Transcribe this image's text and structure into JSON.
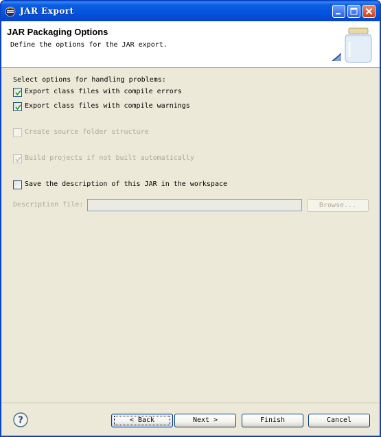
{
  "window": {
    "title": "JAR Export"
  },
  "header": {
    "title": "JAR Packaging Options",
    "description": "Define the options for the JAR export."
  },
  "options": {
    "section_label": "Select options for handling problems:",
    "items": [
      {
        "label": "Export class files with compile errors",
        "checked": true,
        "enabled": true
      },
      {
        "label": "Export class files with compile warnings",
        "checked": true,
        "enabled": true
      },
      {
        "label": "Create source folder structure",
        "checked": false,
        "enabled": false
      },
      {
        "label": "Build projects if not built automatically",
        "checked": true,
        "enabled": false
      },
      {
        "label": "Save the description of this JAR in the workspace",
        "checked": false,
        "enabled": true
      }
    ]
  },
  "description_file": {
    "label": "Description file:",
    "value": "",
    "browse_label": "Browse..."
  },
  "footer": {
    "back_label": "< Back",
    "next_label": "Next >",
    "finish_label": "Finish",
    "cancel_label": "Cancel"
  },
  "colors": {
    "title_bar": "#0553de",
    "dialog_bg": "#ece9d8",
    "disabled_text": "#aca899"
  },
  "icons": [
    "window-app-icon",
    "minimize-icon",
    "maximize-icon",
    "close-icon",
    "jar-banner-icon",
    "help-icon",
    "checkmark-icon"
  ]
}
